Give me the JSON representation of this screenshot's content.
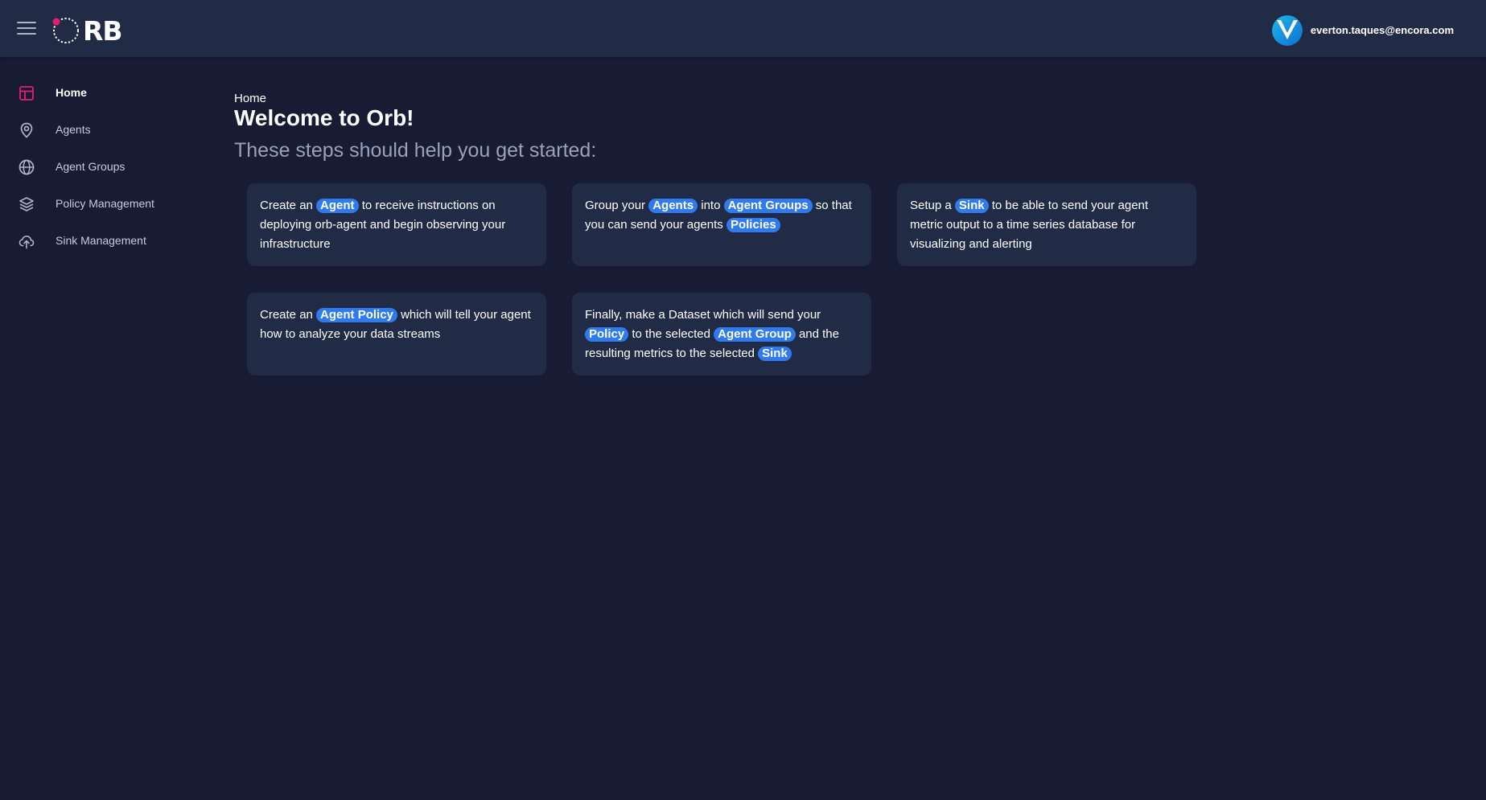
{
  "header": {
    "logo_text": "RB",
    "user_email": "everton.taques@encora.com"
  },
  "sidebar": {
    "items": [
      {
        "label": "Home",
        "icon": "layout-icon",
        "active": true
      },
      {
        "label": "Agents",
        "icon": "map-pin-icon"
      },
      {
        "label": "Agent Groups",
        "icon": "globe-icon"
      },
      {
        "label": "Policy Management",
        "icon": "layers-icon"
      },
      {
        "label": "Sink Management",
        "icon": "cloud-upload-icon"
      }
    ]
  },
  "main": {
    "breadcrumb": "Home",
    "title": "Welcome to Orb!",
    "subtitle": "These steps should help you get started:",
    "cards": [
      {
        "t1": "Create an",
        "p1": "Agent",
        "t2": "to receive instructions on deploying orb-agent and begin observing your infrastructure"
      },
      {
        "t1": "Group your",
        "p1": "Agents",
        "t2": "into",
        "p2": "Agent Groups",
        "t3": "so that you can send your agents",
        "p3": "Policies"
      },
      {
        "t1": "Setup a",
        "p1": "Sink",
        "t2": "to be able to send your agent metric output to a time series database for visualizing and alerting"
      },
      {
        "t1": "Create an",
        "p1": "Agent Policy",
        "t2": "which will tell your agent how to analyze your data streams"
      },
      {
        "t1": "Finally, make a Dataset which will send your",
        "p1": "Policy",
        "t2": "to the selected",
        "p2": "Agent Group",
        "t3": "and the resulting metrics to the selected",
        "p3": "Sink"
      }
    ]
  },
  "colors": {
    "background": "#171c34",
    "header": "#222b45",
    "card": "#222b45",
    "pill": "#2f7bee",
    "active_icon": "#e0206f"
  }
}
